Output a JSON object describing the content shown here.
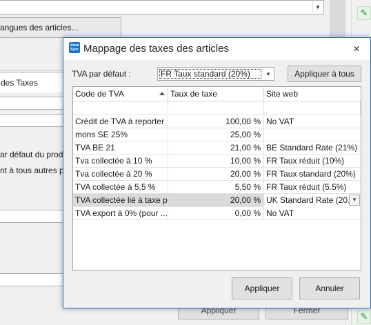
{
  "background": {
    "lang_button": "angues des articles...",
    "tab_label": "des Taxes",
    "text_line1": "ar défaut du produi",
    "text_line2": "nt à tous autres prix",
    "bottom_btn_left": "Appliquer",
    "bottom_btn_right": "Fermer"
  },
  "dialog": {
    "title": "Mappage des taxes des articles",
    "app_icon_text": "Atom Sync",
    "close_icon": "×",
    "default_vat_label": "TVA par défaut :",
    "default_vat_value": "FR Taux standard (20%)",
    "apply_all_button": "Appliquer à tous",
    "apply_button": "Appliquer",
    "cancel_button": "Annuler"
  },
  "grid": {
    "columns": [
      "Code de TVA",
      "Taux de taxe",
      "Site web"
    ],
    "rows": [
      {
        "code": "Crédit de TVA à reporter",
        "rate": "100,00 %",
        "site": "No VAT"
      },
      {
        "code": "mons SE 25%",
        "rate": "25,00 %",
        "site": ""
      },
      {
        "code": "TVA BE 21",
        "rate": "21,00 %",
        "site": "BE Standard Rate (21%)"
      },
      {
        "code": "Tva collectée à 10 %",
        "rate": "10,00 %",
        "site": "FR Taux réduit (10%)"
      },
      {
        "code": "Tva collectée à 20 %",
        "rate": "20,00 %",
        "site": "FR Taux standard (20%)"
      },
      {
        "code": "TVA collectée à 5,5 %",
        "rate": "5,50 %",
        "site": "FR Taux réduit (5.5%)"
      },
      {
        "code": "TVA collectée lié à taxe p...",
        "rate": "20,00 %",
        "site": "UK Standard Rate (20..."
      },
      {
        "code": "TVA export à 0% (pour ...",
        "rate": "0,00 %",
        "site": "No VAT"
      }
    ],
    "selected_row_index": 6
  },
  "colors": {
    "dialog_border": "#1e6fc2",
    "selected_row": "#dadada",
    "button_face": "#e1e1e1"
  }
}
